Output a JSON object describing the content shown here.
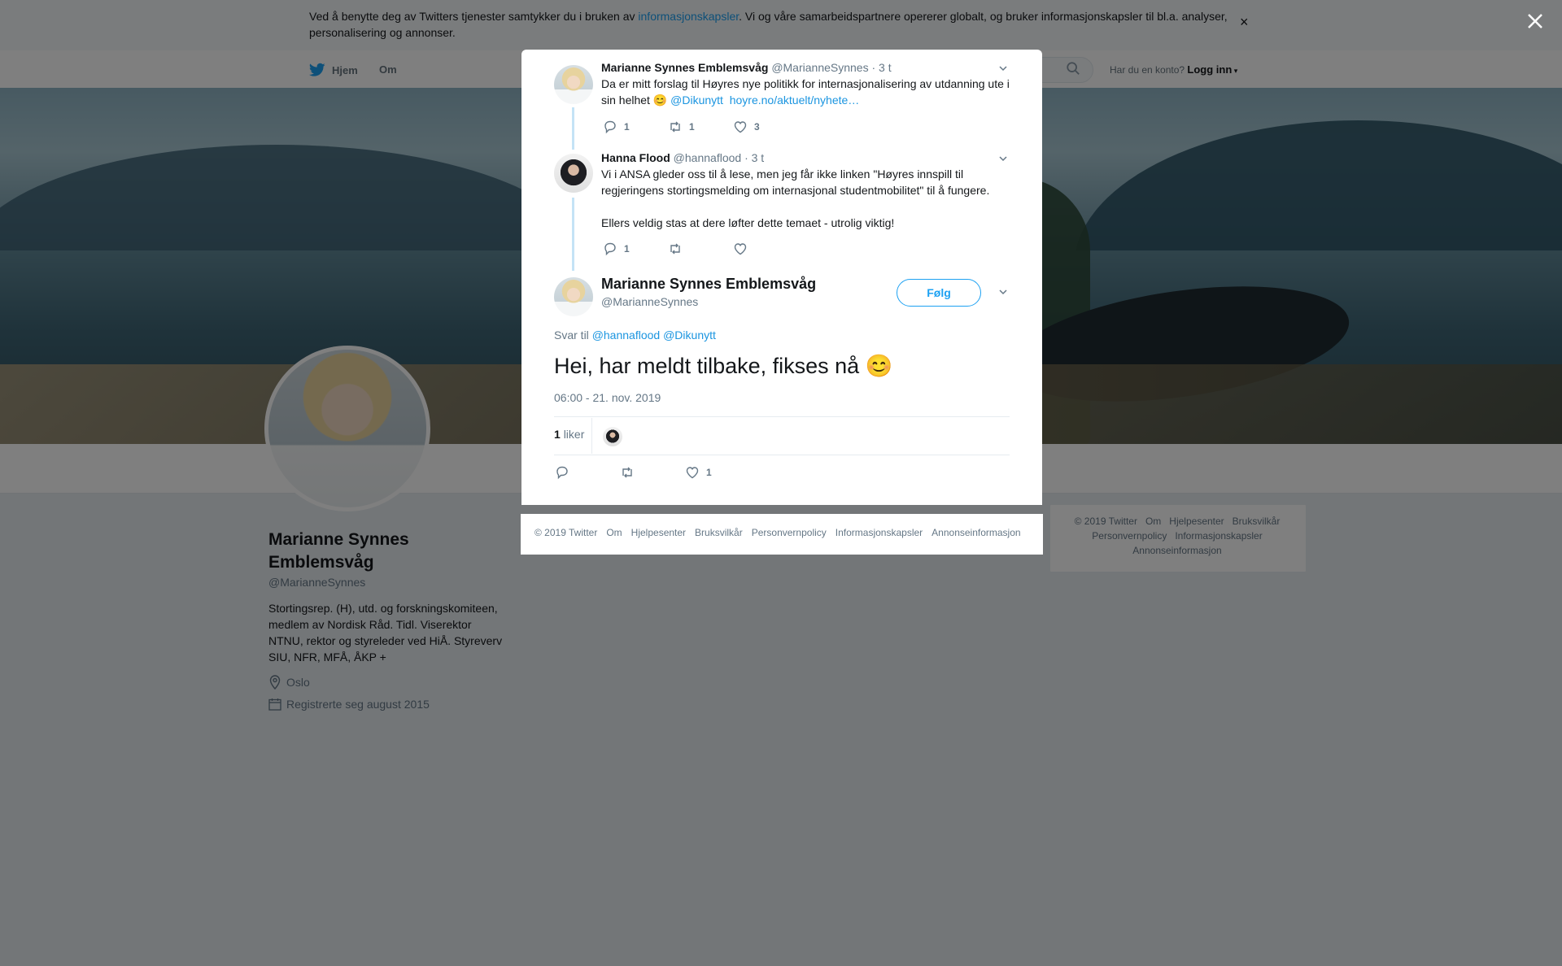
{
  "cookie_banner": {
    "text_before": "Ved å benytte deg av Twitters tjenester samtykker du i bruken av ",
    "link": "informasjonskapsler",
    "text_after": ". Vi og våre samarbeidspartnere opererer globalt, og bruker informasjonskapsler til bl.a. analyser, personalisering og annonser.",
    "close": "×"
  },
  "nav": {
    "home": "Hjem",
    "about": "Om",
    "login_prompt": "Har du en konto?",
    "login": "Logg inn"
  },
  "profile": {
    "name": "Marianne Synnes Emblemsvåg",
    "handle": "@MarianneSynnes",
    "bio": "Stortingsrep. (H), utd. og forskningskomiteen, medlem av Nordisk Råd. Tidl. Viserektor NTNU, rektor og styreleder ved HiÅ. Styreverv SIU, NFR, MFÅ, ÅKP +",
    "location": "Oslo",
    "joined": "Registrerte seg august 2015"
  },
  "thread": [
    {
      "name": "Marianne Synnes Emblemsvåg",
      "handle": "@MarianneSynnes",
      "time": "· 3 t",
      "text": "Da er mitt forslag til Høyres nye politikk for internasjonalisering av utdanning ute i sin helhet",
      "emoji": "😊",
      "mention": "@Dikunytt",
      "link": "hoyre.no/aktuelt/nyhete…",
      "replies": "1",
      "retweets": "1",
      "likes": "3"
    },
    {
      "name": "Hanna Flood",
      "handle": "@hannaflood",
      "time": "· 3 t",
      "text1": "Vi i ANSA gleder oss til å lese, men jeg får ikke linken \"Høyres innspill til regjeringens stortingsmelding om internasjonal studentmobilitet\" til å fungere.",
      "text2": "Ellers veldig stas at dere løfter dette temaet - utrolig viktig!",
      "replies": "1",
      "retweets": "",
      "likes": ""
    }
  ],
  "main_tweet": {
    "name": "Marianne Synnes Emblemsvåg",
    "handle": "@MarianneSynnes",
    "follow": "Følg",
    "reply_to_label": "Svar til",
    "reply_to_1": "@hannaflood",
    "reply_to_2": "@Dikunytt",
    "text": "Hei, har meldt tilbake, fikses nå",
    "emoji": "😊",
    "timestamp": "06:00 - 21. nov. 2019",
    "like_count": "1",
    "like_label": "liker",
    "likes_action": "1"
  },
  "modal_footer": [
    "© 2019 Twitter",
    "Om",
    "Hjelpesenter",
    "Bruksvilkår",
    "Personvernpolicy",
    "Informasjonskapsler",
    "Annonseinformasjon"
  ],
  "side_footer": [
    "© 2019 Twitter",
    "Om",
    "Hjelpesenter",
    "Bruksvilkår",
    "Personvernpolicy",
    "Informasjonskapsler",
    "Annonseinformasjon"
  ],
  "colors": {
    "brand": "#1da1f2",
    "link": "#1b95e0",
    "thread_line": "#c4e3f6"
  }
}
